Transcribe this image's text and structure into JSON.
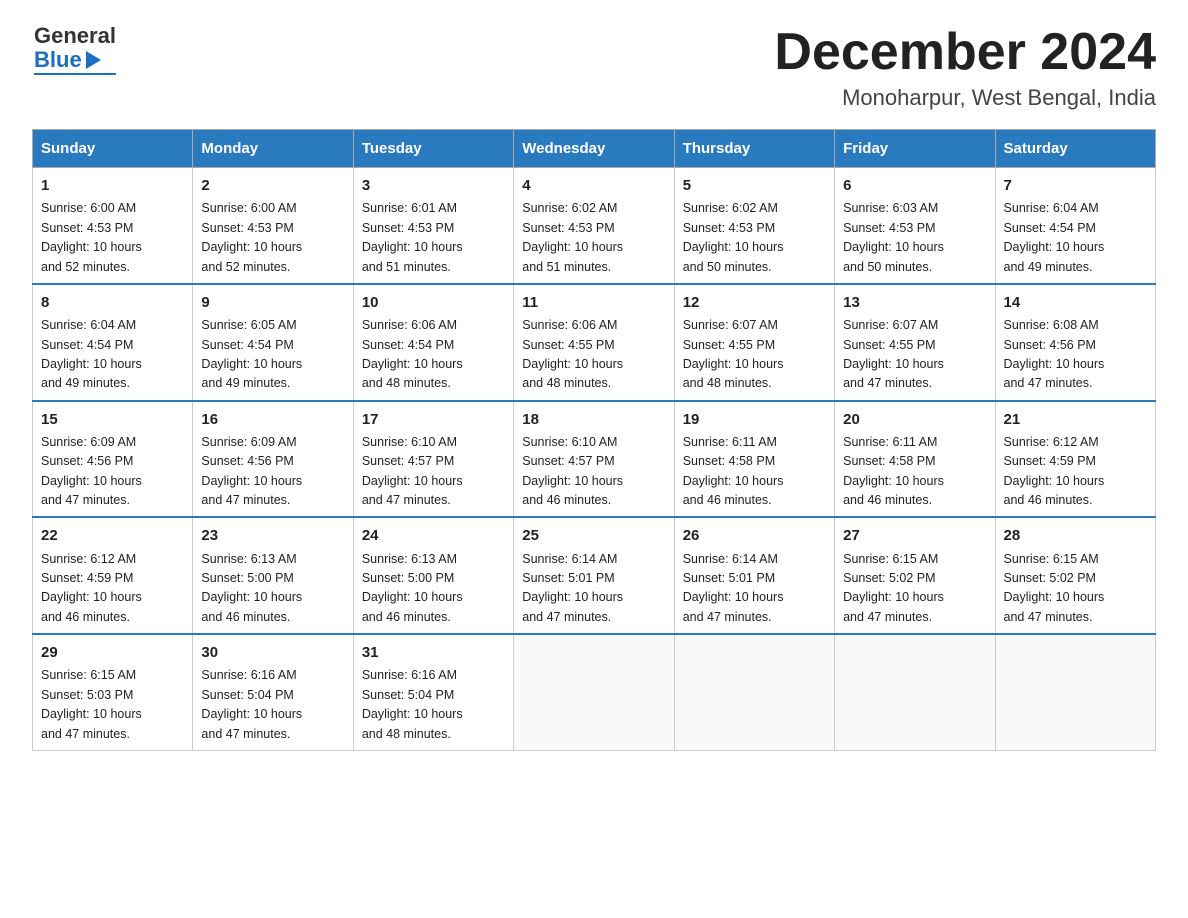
{
  "header": {
    "month_title": "December 2024",
    "location": "Monoharpur, West Bengal, India",
    "logo_general": "General",
    "logo_blue": "Blue"
  },
  "weekdays": [
    "Sunday",
    "Monday",
    "Tuesday",
    "Wednesday",
    "Thursday",
    "Friday",
    "Saturday"
  ],
  "weeks": [
    [
      {
        "day": "1",
        "info": "Sunrise: 6:00 AM\nSunset: 4:53 PM\nDaylight: 10 hours\nand 52 minutes."
      },
      {
        "day": "2",
        "info": "Sunrise: 6:00 AM\nSunset: 4:53 PM\nDaylight: 10 hours\nand 52 minutes."
      },
      {
        "day": "3",
        "info": "Sunrise: 6:01 AM\nSunset: 4:53 PM\nDaylight: 10 hours\nand 51 minutes."
      },
      {
        "day": "4",
        "info": "Sunrise: 6:02 AM\nSunset: 4:53 PM\nDaylight: 10 hours\nand 51 minutes."
      },
      {
        "day": "5",
        "info": "Sunrise: 6:02 AM\nSunset: 4:53 PM\nDaylight: 10 hours\nand 50 minutes."
      },
      {
        "day": "6",
        "info": "Sunrise: 6:03 AM\nSunset: 4:53 PM\nDaylight: 10 hours\nand 50 minutes."
      },
      {
        "day": "7",
        "info": "Sunrise: 6:04 AM\nSunset: 4:54 PM\nDaylight: 10 hours\nand 49 minutes."
      }
    ],
    [
      {
        "day": "8",
        "info": "Sunrise: 6:04 AM\nSunset: 4:54 PM\nDaylight: 10 hours\nand 49 minutes."
      },
      {
        "day": "9",
        "info": "Sunrise: 6:05 AM\nSunset: 4:54 PM\nDaylight: 10 hours\nand 49 minutes."
      },
      {
        "day": "10",
        "info": "Sunrise: 6:06 AM\nSunset: 4:54 PM\nDaylight: 10 hours\nand 48 minutes."
      },
      {
        "day": "11",
        "info": "Sunrise: 6:06 AM\nSunset: 4:55 PM\nDaylight: 10 hours\nand 48 minutes."
      },
      {
        "day": "12",
        "info": "Sunrise: 6:07 AM\nSunset: 4:55 PM\nDaylight: 10 hours\nand 48 minutes."
      },
      {
        "day": "13",
        "info": "Sunrise: 6:07 AM\nSunset: 4:55 PM\nDaylight: 10 hours\nand 47 minutes."
      },
      {
        "day": "14",
        "info": "Sunrise: 6:08 AM\nSunset: 4:56 PM\nDaylight: 10 hours\nand 47 minutes."
      }
    ],
    [
      {
        "day": "15",
        "info": "Sunrise: 6:09 AM\nSunset: 4:56 PM\nDaylight: 10 hours\nand 47 minutes."
      },
      {
        "day": "16",
        "info": "Sunrise: 6:09 AM\nSunset: 4:56 PM\nDaylight: 10 hours\nand 47 minutes."
      },
      {
        "day": "17",
        "info": "Sunrise: 6:10 AM\nSunset: 4:57 PM\nDaylight: 10 hours\nand 47 minutes."
      },
      {
        "day": "18",
        "info": "Sunrise: 6:10 AM\nSunset: 4:57 PM\nDaylight: 10 hours\nand 46 minutes."
      },
      {
        "day": "19",
        "info": "Sunrise: 6:11 AM\nSunset: 4:58 PM\nDaylight: 10 hours\nand 46 minutes."
      },
      {
        "day": "20",
        "info": "Sunrise: 6:11 AM\nSunset: 4:58 PM\nDaylight: 10 hours\nand 46 minutes."
      },
      {
        "day": "21",
        "info": "Sunrise: 6:12 AM\nSunset: 4:59 PM\nDaylight: 10 hours\nand 46 minutes."
      }
    ],
    [
      {
        "day": "22",
        "info": "Sunrise: 6:12 AM\nSunset: 4:59 PM\nDaylight: 10 hours\nand 46 minutes."
      },
      {
        "day": "23",
        "info": "Sunrise: 6:13 AM\nSunset: 5:00 PM\nDaylight: 10 hours\nand 46 minutes."
      },
      {
        "day": "24",
        "info": "Sunrise: 6:13 AM\nSunset: 5:00 PM\nDaylight: 10 hours\nand 46 minutes."
      },
      {
        "day": "25",
        "info": "Sunrise: 6:14 AM\nSunset: 5:01 PM\nDaylight: 10 hours\nand 47 minutes."
      },
      {
        "day": "26",
        "info": "Sunrise: 6:14 AM\nSunset: 5:01 PM\nDaylight: 10 hours\nand 47 minutes."
      },
      {
        "day": "27",
        "info": "Sunrise: 6:15 AM\nSunset: 5:02 PM\nDaylight: 10 hours\nand 47 minutes."
      },
      {
        "day": "28",
        "info": "Sunrise: 6:15 AM\nSunset: 5:02 PM\nDaylight: 10 hours\nand 47 minutes."
      }
    ],
    [
      {
        "day": "29",
        "info": "Sunrise: 6:15 AM\nSunset: 5:03 PM\nDaylight: 10 hours\nand 47 minutes."
      },
      {
        "day": "30",
        "info": "Sunrise: 6:16 AM\nSunset: 5:04 PM\nDaylight: 10 hours\nand 47 minutes."
      },
      {
        "day": "31",
        "info": "Sunrise: 6:16 AM\nSunset: 5:04 PM\nDaylight: 10 hours\nand 48 minutes."
      },
      {
        "day": "",
        "info": ""
      },
      {
        "day": "",
        "info": ""
      },
      {
        "day": "",
        "info": ""
      },
      {
        "day": "",
        "info": ""
      }
    ]
  ]
}
